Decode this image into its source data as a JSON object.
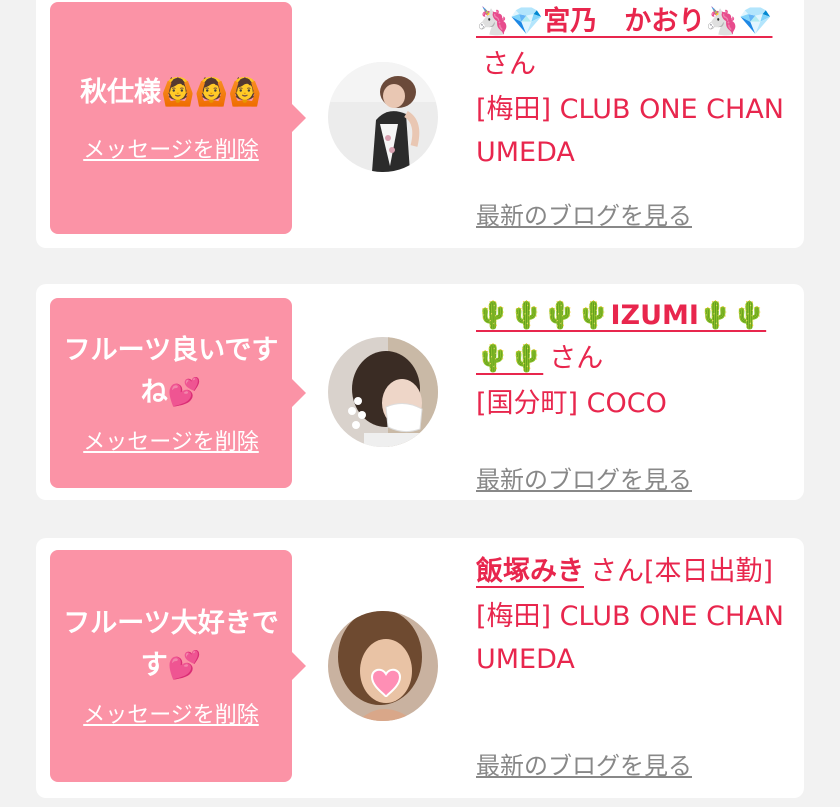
{
  "cards": [
    {
      "message": "秋仕様🙆🙆🙆",
      "delete_label": "メッセージを削除",
      "name": "🦄💎宮乃　かおり🦄💎",
      "honorific": "さん",
      "shop": "[梅田] CLUB ONE CHAN UMEDA",
      "blog_label": "最新のブログを見る"
    },
    {
      "message": "フルーツ良いですね💕",
      "delete_label": "メッセージを削除",
      "name": "🌵🌵🌵🌵IZUMI🌵🌵🌵🌵",
      "honorific": "さん",
      "shop": "[国分町] COCO",
      "blog_label": "最新のブログを見る"
    },
    {
      "message": "フルーツ大好きです💕",
      "delete_label": "メッセージを削除",
      "name": "飯塚みき",
      "honorific": "さん[本日出勤]",
      "shop": "[梅田] CLUB ONE CHAN UMEDA",
      "blog_label": "最新のブログを見る"
    }
  ]
}
